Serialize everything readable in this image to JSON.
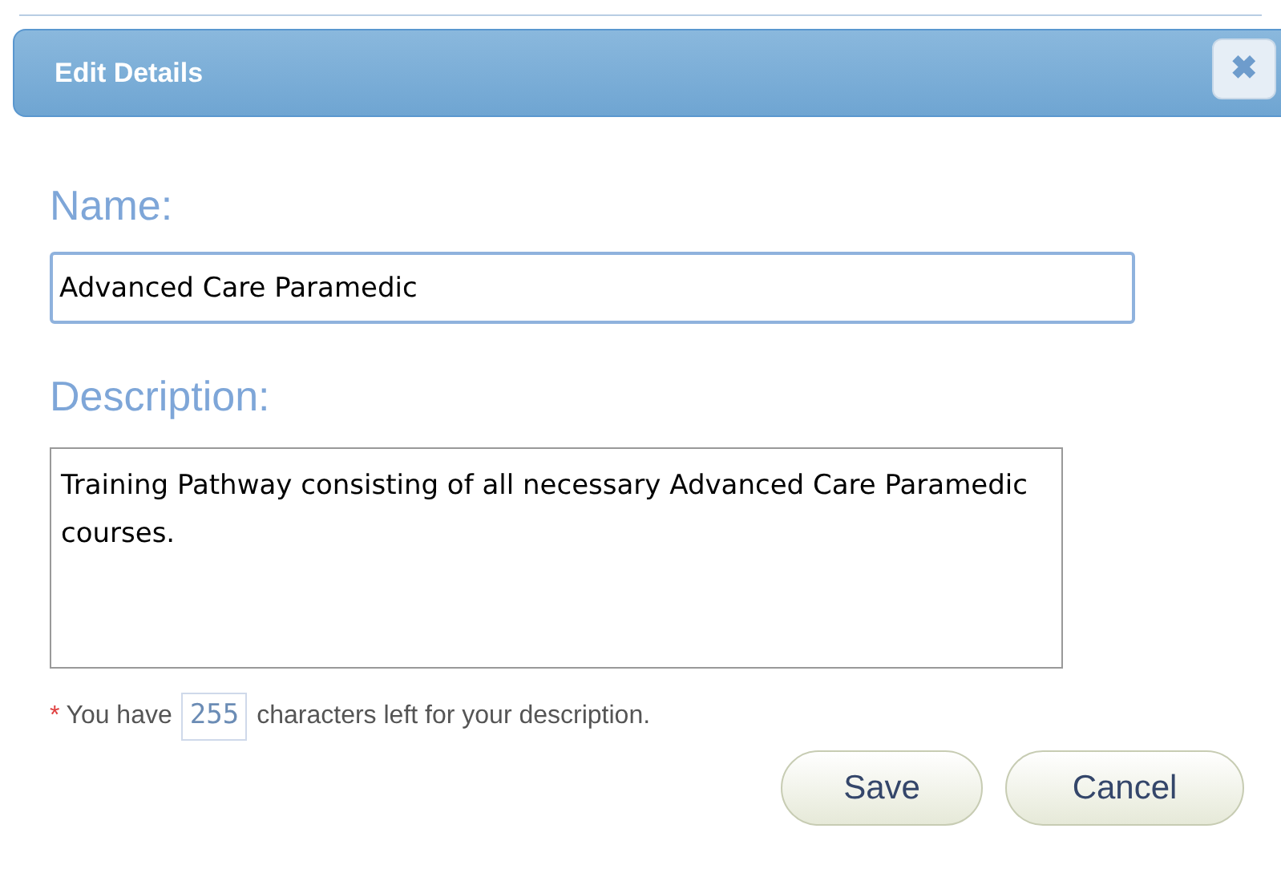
{
  "dialog": {
    "title": "Edit Details",
    "close": "✖"
  },
  "name_field": {
    "label": "Name:",
    "value": "Advanced Care Paramedic"
  },
  "description_field": {
    "label": "Description:",
    "value": "Training Pathway consisting of all necessary Advanced Care Paramedic courses."
  },
  "counter": {
    "required_mark": "*",
    "prefix": "You have",
    "count": "255",
    "suffix": "characters left for your description."
  },
  "buttons": [
    "Save",
    "Cancel"
  ]
}
